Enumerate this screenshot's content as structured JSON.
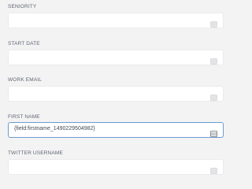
{
  "form": {
    "fields": [
      {
        "label": "SENIORITY",
        "value": "",
        "icon": "list-card-icon",
        "focused": false
      },
      {
        "label": "START DATE",
        "value": "",
        "icon": "list-card-icon",
        "focused": false
      },
      {
        "label": "WORK EMAIL",
        "value": "",
        "icon": "list-card-icon",
        "focused": false
      },
      {
        "label": "FIRST NAME",
        "value": "{field:firstname_1490229504982}",
        "icon": "list-card-icon",
        "focused": true
      },
      {
        "label": "TWITTER USERNAME",
        "value": "",
        "icon": "list-card-icon",
        "focused": false
      }
    ]
  },
  "colors": {
    "background": "#f3f3f4",
    "input_border": "#ebebed",
    "focus_border": "#6f9bd1",
    "label_text": "#5f6670"
  }
}
